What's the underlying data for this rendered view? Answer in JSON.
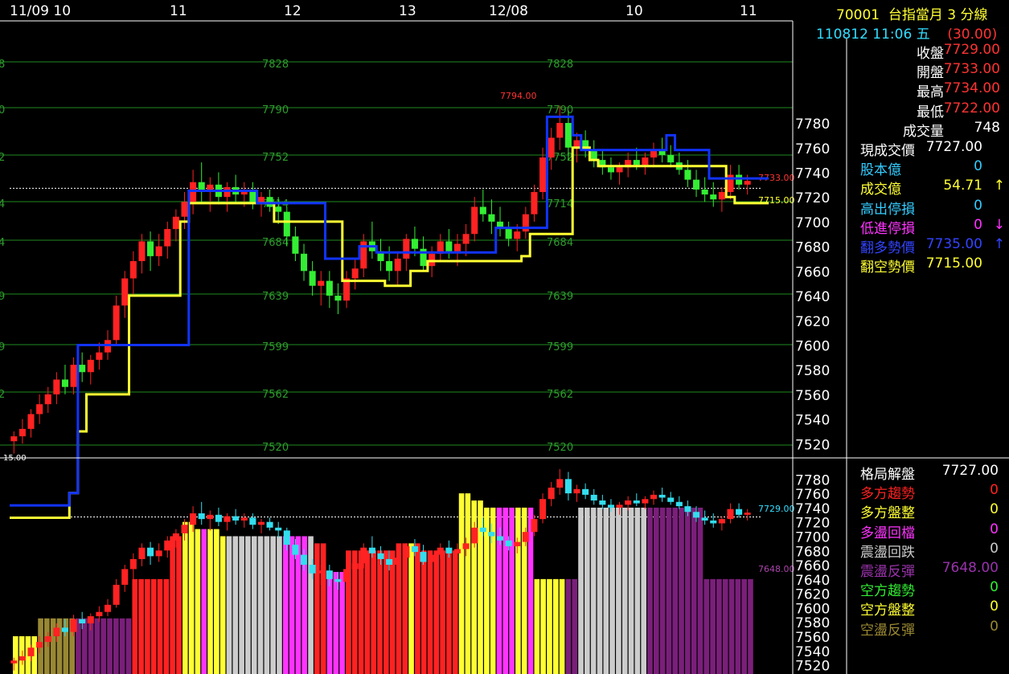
{
  "header": {
    "symbol": "70001",
    "name": "台指當月 3 分線",
    "datetime": "110812 11:06 五",
    "change": "(30.00)"
  },
  "quote": [
    {
      "label": "收盤",
      "value": "7729.00",
      "label_color": "#ffffff",
      "value_color": "#ff3333"
    },
    {
      "label": "開盤",
      "value": "7733.00",
      "label_color": "#ffffff",
      "value_color": "#ff3333"
    },
    {
      "label": "最高",
      "value": "7734.00",
      "label_color": "#ffffff",
      "value_color": "#ff3333"
    },
    {
      "label": "最低",
      "value": "7722.00",
      "label_color": "#ffffff",
      "value_color": "#ff3333"
    },
    {
      "label": "成交量",
      "value": "748",
      "label_color": "#ffffff",
      "value_color": "#ffffff"
    }
  ],
  "indicators": [
    {
      "label": "現成交價",
      "value": "7727.00",
      "arrow": "",
      "label_color": "#ffffff",
      "value_color": "#ffffff"
    },
    {
      "label": "股本億",
      "value": "0",
      "arrow": "",
      "label_color": "#33ccff",
      "value_color": "#33ccff"
    },
    {
      "label": "成交億",
      "value": "54.71",
      "arrow": "↑",
      "label_color": "#ffff33",
      "value_color": "#ffff33"
    },
    {
      "label": "高出停損",
      "value": "0",
      "arrow": "",
      "label_color": "#33ccff",
      "value_color": "#33ccff"
    },
    {
      "label": "低進停損",
      "value": "0",
      "arrow": "↓",
      "label_color": "#ff33ff",
      "value_color": "#ff33ff"
    },
    {
      "label": "翻多勢價",
      "value": "7735.00",
      "arrow": "↑",
      "label_color": "#3344ff",
      "value_color": "#3344ff"
    },
    {
      "label": "翻空勢價",
      "value": "7715.00",
      "arrow": "",
      "label_color": "#ffff33",
      "value_color": "#ffff33"
    }
  ],
  "pattern": [
    {
      "label": "格局解盤",
      "value": "7727.00",
      "label_color": "#ffffff",
      "value_color": "#ffffff"
    },
    {
      "label": "多方趨勢",
      "value": "0",
      "label_color": "#ff2222",
      "value_color": "#ff2222"
    },
    {
      "label": "多方盤整",
      "value": "0",
      "label_color": "#ffff33",
      "value_color": "#ffff33"
    },
    {
      "label": "多盪回檔",
      "value": "0",
      "label_color": "#ff33ff",
      "value_color": "#ff33ff"
    },
    {
      "label": "震盪回跌",
      "value": "0",
      "label_color": "#cccccc",
      "value_color": "#cccccc"
    },
    {
      "label": "震盪反彈",
      "value": "7648.00",
      "label_color": "#9933aa",
      "value_color": "#9933aa"
    },
    {
      "label": "空方趨勢",
      "value": "0",
      "label_color": "#33ee33",
      "value_color": "#33ee33"
    },
    {
      "label": "空方盤整",
      "value": "0",
      "label_color": "#ffff33",
      "value_color": "#ffff33"
    },
    {
      "label": "空盪反彈",
      "value": "0",
      "label_color": "#998833",
      "value_color": "#998833"
    }
  ],
  "chart_data": {
    "type": "candlestick",
    "x_labels": [
      "11/09 10",
      "11",
      "12",
      "13",
      "12/08",
      "10",
      "11"
    ],
    "y_ticks": [
      7520,
      7540,
      7560,
      7580,
      7600,
      7620,
      7640,
      7660,
      7680,
      7700,
      7720,
      7740,
      7760,
      7780
    ],
    "ylim": [
      7515,
      7795
    ],
    "levels": [
      7828,
      7790,
      7752,
      7714,
      7684,
      7639,
      7599,
      7562,
      7520
    ],
    "level_edge_labels": [
      "8",
      "0",
      "2",
      "4",
      "4",
      "9",
      "9",
      "2"
    ],
    "annotations": {
      "high": "7794.00",
      "last": "7733.00",
      "flip_short": "7715.00",
      "lower_last": "7729.00",
      "lower_rebound": "7648.00",
      "edge_left": "15.00"
    },
    "candles": [
      [
        7522,
        7530,
        7512,
        7526
      ],
      [
        7526,
        7540,
        7520,
        7532
      ],
      [
        7532,
        7548,
        7525,
        7544
      ],
      [
        7544,
        7560,
        7536,
        7552
      ],
      [
        7552,
        7566,
        7545,
        7560
      ],
      [
        7560,
        7578,
        7552,
        7572
      ],
      [
        7572,
        7584,
        7560,
        7566
      ],
      [
        7566,
        7590,
        7560,
        7584
      ],
      [
        7584,
        7594,
        7570,
        7578
      ],
      [
        7578,
        7592,
        7568,
        7588
      ],
      [
        7588,
        7602,
        7580,
        7594
      ],
      [
        7594,
        7612,
        7588,
        7604
      ],
      [
        7604,
        7640,
        7600,
        7632
      ],
      [
        7632,
        7660,
        7622,
        7654
      ],
      [
        7654,
        7676,
        7640,
        7668
      ],
      [
        7668,
        7690,
        7658,
        7684
      ],
      [
        7684,
        7692,
        7660,
        7672
      ],
      [
        7672,
        7690,
        7664,
        7680
      ],
      [
        7680,
        7700,
        7670,
        7694
      ],
      [
        7694,
        7710,
        7684,
        7704
      ],
      [
        7704,
        7724,
        7694,
        7716
      ],
      [
        7716,
        7742,
        7706,
        7732
      ],
      [
        7732,
        7748,
        7716,
        7724
      ],
      [
        7724,
        7736,
        7708,
        7730
      ],
      [
        7730,
        7740,
        7714,
        7720
      ],
      [
        7720,
        7732,
        7708,
        7728
      ],
      [
        7728,
        7738,
        7716,
        7722
      ],
      [
        7722,
        7732,
        7712,
        7726
      ],
      [
        7726,
        7732,
        7710,
        7716
      ],
      [
        7716,
        7724,
        7704,
        7720
      ],
      [
        7720,
        7726,
        7708,
        7712
      ],
      [
        7712,
        7720,
        7698,
        7708
      ],
      [
        7708,
        7712,
        7680,
        7688
      ],
      [
        7688,
        7696,
        7668,
        7674
      ],
      [
        7674,
        7682,
        7652,
        7660
      ],
      [
        7660,
        7668,
        7640,
        7648
      ],
      [
        7648,
        7660,
        7632,
        7652
      ],
      [
        7652,
        7660,
        7630,
        7640
      ],
      [
        7640,
        7650,
        7625,
        7636
      ],
      [
        7636,
        7660,
        7630,
        7654
      ],
      [
        7654,
        7670,
        7645,
        7662
      ],
      [
        7662,
        7690,
        7655,
        7684
      ],
      [
        7684,
        7700,
        7670,
        7676
      ],
      [
        7676,
        7686,
        7660,
        7668
      ],
      [
        7668,
        7680,
        7652,
        7660
      ],
      [
        7660,
        7676,
        7648,
        7670
      ],
      [
        7670,
        7690,
        7660,
        7686
      ],
      [
        7686,
        7696,
        7672,
        7678
      ],
      [
        7678,
        7688,
        7660,
        7664
      ],
      [
        7664,
        7680,
        7655,
        7674
      ],
      [
        7674,
        7690,
        7668,
        7684
      ],
      [
        7684,
        7694,
        7670,
        7676
      ],
      [
        7676,
        7690,
        7664,
        7682
      ],
      [
        7682,
        7698,
        7672,
        7690
      ],
      [
        7690,
        7720,
        7684,
        7712
      ],
      [
        7712,
        7726,
        7700,
        7706
      ],
      [
        7706,
        7718,
        7690,
        7700
      ],
      [
        7700,
        7712,
        7688,
        7694
      ],
      [
        7694,
        7700,
        7680,
        7686
      ],
      [
        7686,
        7698,
        7676,
        7692
      ],
      [
        7692,
        7712,
        7686,
        7706
      ],
      [
        7706,
        7730,
        7700,
        7724
      ],
      [
        7724,
        7760,
        7718,
        7752
      ],
      [
        7752,
        7776,
        7742,
        7768
      ],
      [
        7768,
        7794,
        7758,
        7780
      ],
      [
        7780,
        7790,
        7750,
        7760
      ],
      [
        7760,
        7772,
        7748,
        7766
      ],
      [
        7766,
        7774,
        7752,
        7758
      ],
      [
        7758,
        7766,
        7744,
        7750
      ],
      [
        7750,
        7758,
        7738,
        7744
      ],
      [
        7744,
        7752,
        7734,
        7740
      ],
      [
        7740,
        7748,
        7730,
        7744
      ],
      [
        7744,
        7756,
        7736,
        7750
      ],
      [
        7750,
        7760,
        7742,
        7746
      ],
      [
        7746,
        7756,
        7738,
        7752
      ],
      [
        7752,
        7764,
        7744,
        7758
      ],
      [
        7758,
        7768,
        7748,
        7754
      ],
      [
        7754,
        7762,
        7744,
        7748
      ],
      [
        7748,
        7756,
        7738,
        7742
      ],
      [
        7742,
        7750,
        7728,
        7734
      ],
      [
        7734,
        7742,
        7720,
        7726
      ],
      [
        7726,
        7736,
        7716,
        7722
      ],
      [
        7722,
        7732,
        7712,
        7718
      ],
      [
        7718,
        7728,
        7708,
        7724
      ],
      [
        7724,
        7746,
        7718,
        7738
      ],
      [
        7738,
        7746,
        7726,
        7730
      ],
      [
        7730,
        7738,
        7722,
        7733
      ]
    ],
    "series": [
      {
        "name": "翻空勢價",
        "color": "#ffff33",
        "values": [
          7460,
          7460,
          7460,
          7460,
          7460,
          7460,
          7460,
          7480,
          7530,
          7560,
          7560,
          7560,
          7560,
          7560,
          7640,
          7640,
          7640,
          7640,
          7640,
          7640,
          7700,
          7715,
          7715,
          7715,
          7715,
          7715,
          7715,
          7715,
          7715,
          7715,
          7715,
          7700,
          7700,
          7700,
          7700,
          7700,
          7700,
          7700,
          7700,
          7652,
          7652,
          7652,
          7652,
          7652,
          7648,
          7648,
          7648,
          7660,
          7660,
          7668,
          7668,
          7668,
          7668,
          7668,
          7668,
          7668,
          7668,
          7668,
          7668,
          7668,
          7672,
          7690,
          7690,
          7690,
          7690,
          7690,
          7760,
          7760,
          7750,
          7745,
          7745,
          7745,
          7745,
          7745,
          7745,
          7745,
          7745,
          7745,
          7745,
          7745,
          7745,
          7745,
          7745,
          7745,
          7720,
          7715,
          7715,
          7715,
          7715
        ]
      },
      {
        "name": "翻多勢價",
        "color": "#1133ff",
        "values": [
          7470,
          7470,
          7470,
          7470,
          7470,
          7470,
          7470,
          7480,
          7600,
          7600,
          7600,
          7600,
          7600,
          7600,
          7600,
          7600,
          7600,
          7600,
          7600,
          7600,
          7600,
          7725,
          7725,
          7725,
          7725,
          7725,
          7725,
          7725,
          7725,
          7715,
          7715,
          7715,
          7715,
          7715,
          7715,
          7715,
          7715,
          7670,
          7670,
          7670,
          7670,
          7680,
          7680,
          7675,
          7675,
          7675,
          7675,
          7675,
          7675,
          7675,
          7675,
          7675,
          7675,
          7675,
          7675,
          7675,
          7675,
          7695,
          7695,
          7695,
          7695,
          7695,
          7695,
          7785,
          7785,
          7785,
          7770,
          7758,
          7758,
          7758,
          7758,
          7758,
          7758,
          7758,
          7758,
          7758,
          7758,
          7770,
          7758,
          7758,
          7758,
          7758,
          7735,
          7735,
          7735,
          7735,
          7735,
          7735,
          7735
        ]
      }
    ],
    "lower_panel": {
      "y_ticks": [
        7520,
        7540,
        7560,
        7580,
        7600,
        7620,
        7640,
        7660,
        7680,
        7700,
        7720,
        7740,
        7760,
        7780
      ],
      "ylim": [
        7515,
        7795
      ],
      "bar_bottom": 7515,
      "bar_top_values": [
        7560,
        7560,
        7560,
        7560,
        7585,
        7585,
        7585,
        7585,
        7585,
        7585,
        7585,
        7585,
        7585,
        7585,
        7585,
        7585,
        7585,
        7585,
        7585,
        7640,
        7640,
        7640,
        7640,
        7640,
        7640,
        7700,
        7700,
        7720,
        7720,
        7710,
        7710,
        7710,
        7710,
        7700,
        7700,
        7700,
        7700,
        7700,
        7700,
        7700,
        7700,
        7700,
        7700,
        7700,
        7700,
        7700,
        7700,
        7700,
        7690,
        7690,
        7650,
        7650,
        7650,
        7680,
        7680,
        7680,
        7680,
        7680,
        7680,
        7680,
        7680,
        7690,
        7690,
        7690,
        7690,
        7680,
        7680,
        7680,
        7680,
        7680,
        7680,
        7760,
        7760,
        7750,
        7750,
        7740,
        7740,
        7740,
        7740,
        7740,
        7740,
        7740,
        7740,
        7640,
        7640,
        7640,
        7640,
        7640,
        7640,
        7640,
        7740,
        7740,
        7740,
        7740,
        7740,
        7740,
        7740,
        7740,
        7740,
        7740,
        7740,
        7740,
        7740,
        7740,
        7740,
        7740,
        7740,
        7740,
        7740,
        7740,
        7640,
        7640,
        7640,
        7640,
        7640,
        7640,
        7640,
        7640
      ],
      "bar_classes": [
        "多方盤整",
        "多方盤整",
        "多方盤整",
        "多方盤整",
        "空盪反彈",
        "空盪反彈",
        "空盪反彈",
        "空盪反彈",
        "空盪反彈",
        "空盪反彈",
        "震盪反彈",
        "震盪反彈",
        "震盪反彈",
        "震盪反彈",
        "震盪反彈",
        "震盪反彈",
        "震盪反彈",
        "震盪反彈",
        "震盪反彈",
        "多方趨勢",
        "多方趨勢",
        "多方趨勢",
        "多方趨勢",
        "多方趨勢",
        "多方趨勢",
        "多方趨勢",
        "多方趨勢",
        "多方盤整",
        "多方盤整",
        "多方盤整",
        "多盪回檔",
        "多方盤整",
        "多方盤整",
        "多方盤整",
        "震盪回跌",
        "震盪回跌",
        "震盪回跌",
        "震盪回跌",
        "震盪回跌",
        "震盪回跌",
        "震盪回跌",
        "震盪回跌",
        "震盪回跌",
        "多盪回檔",
        "多盪回檔",
        "多盪回檔",
        "多盪回檔",
        "震盪回跌",
        "多方趨勢",
        "多方趨勢",
        "多盪回檔",
        "多盪回檔",
        "多盪回檔",
        "多方趨勢",
        "多方趨勢",
        "多方趨勢",
        "多方趨勢",
        "多方趨勢",
        "多方趨勢",
        "多方趨勢",
        "多方趨勢",
        "多方趨勢",
        "多方趨勢",
        "多方盤整",
        "多方趨勢",
        "多方趨勢",
        "多方趨勢",
        "多方趨勢",
        "多方趨勢",
        "多方趨勢",
        "多方趨勢",
        "多方盤整",
        "多方盤整",
        "多方盤整",
        "多方盤整",
        "多方盤整",
        "多方盤整",
        "多盪回檔",
        "多盪回檔",
        "多盪回檔",
        "多方盤整",
        "多方盤整",
        "多盪回檔",
        "多方盤整",
        "多方盤整",
        "多方盤整",
        "多方盤整",
        "多方盤整",
        "震盪反彈",
        "震盪反彈",
        "震盪回跌",
        "震盪回跌",
        "震盪回跌",
        "震盪回跌",
        "震盪回跌",
        "震盪回跌",
        "震盪回跌",
        "震盪回跌",
        "震盪回跌",
        "震盪回跌",
        "震盪回跌",
        "震盪反彈",
        "震盪反彈",
        "震盪反彈",
        "震盪反彈",
        "震盪反彈",
        "震盪反彈",
        "震盪反彈",
        "震盪反彈",
        "震盪反彈",
        "震盪反彈",
        "震盪反彈",
        "震盪反彈",
        "震盪反彈",
        "震盪反彈",
        "震盪反彈",
        "震盪反彈",
        "震盪反彈"
      ]
    }
  },
  "colors": {
    "up": "#ff2222",
    "down": "#33ee33",
    "grid": "#1f8a1f",
    "axis": "#ffffff",
    "level_text": "#2e9a2e",
    "多方趨勢": "#ff2222",
    "多方盤整": "#ffff33",
    "多盪回檔": "#ff33ff",
    "震盪回跌": "#cccccc",
    "震盪反彈": "#7a1f7a",
    "空盪反彈": "#998833"
  }
}
